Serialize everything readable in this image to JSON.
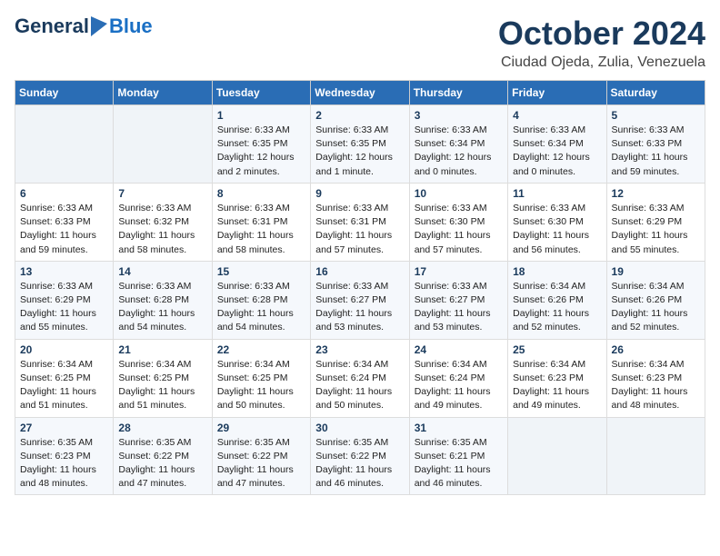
{
  "header": {
    "logo_general": "General",
    "logo_blue": "Blue",
    "month": "October 2024",
    "location": "Ciudad Ojeda, Zulia, Venezuela"
  },
  "days_of_week": [
    "Sunday",
    "Monday",
    "Tuesday",
    "Wednesday",
    "Thursday",
    "Friday",
    "Saturday"
  ],
  "weeks": [
    [
      null,
      null,
      {
        "day": "1",
        "sunrise": "Sunrise: 6:33 AM",
        "sunset": "Sunset: 6:35 PM",
        "daylight": "Daylight: 12 hours and 2 minutes."
      },
      {
        "day": "2",
        "sunrise": "Sunrise: 6:33 AM",
        "sunset": "Sunset: 6:35 PM",
        "daylight": "Daylight: 12 hours and 1 minute."
      },
      {
        "day": "3",
        "sunrise": "Sunrise: 6:33 AM",
        "sunset": "Sunset: 6:34 PM",
        "daylight": "Daylight: 12 hours and 0 minutes."
      },
      {
        "day": "4",
        "sunrise": "Sunrise: 6:33 AM",
        "sunset": "Sunset: 6:34 PM",
        "daylight": "Daylight: 12 hours and 0 minutes."
      },
      {
        "day": "5",
        "sunrise": "Sunrise: 6:33 AM",
        "sunset": "Sunset: 6:33 PM",
        "daylight": "Daylight: 11 hours and 59 minutes."
      }
    ],
    [
      {
        "day": "6",
        "sunrise": "Sunrise: 6:33 AM",
        "sunset": "Sunset: 6:33 PM",
        "daylight": "Daylight: 11 hours and 59 minutes."
      },
      {
        "day": "7",
        "sunrise": "Sunrise: 6:33 AM",
        "sunset": "Sunset: 6:32 PM",
        "daylight": "Daylight: 11 hours and 58 minutes."
      },
      {
        "day": "8",
        "sunrise": "Sunrise: 6:33 AM",
        "sunset": "Sunset: 6:31 PM",
        "daylight": "Daylight: 11 hours and 58 minutes."
      },
      {
        "day": "9",
        "sunrise": "Sunrise: 6:33 AM",
        "sunset": "Sunset: 6:31 PM",
        "daylight": "Daylight: 11 hours and 57 minutes."
      },
      {
        "day": "10",
        "sunrise": "Sunrise: 6:33 AM",
        "sunset": "Sunset: 6:30 PM",
        "daylight": "Daylight: 11 hours and 57 minutes."
      },
      {
        "day": "11",
        "sunrise": "Sunrise: 6:33 AM",
        "sunset": "Sunset: 6:30 PM",
        "daylight": "Daylight: 11 hours and 56 minutes."
      },
      {
        "day": "12",
        "sunrise": "Sunrise: 6:33 AM",
        "sunset": "Sunset: 6:29 PM",
        "daylight": "Daylight: 11 hours and 55 minutes."
      }
    ],
    [
      {
        "day": "13",
        "sunrise": "Sunrise: 6:33 AM",
        "sunset": "Sunset: 6:29 PM",
        "daylight": "Daylight: 11 hours and 55 minutes."
      },
      {
        "day": "14",
        "sunrise": "Sunrise: 6:33 AM",
        "sunset": "Sunset: 6:28 PM",
        "daylight": "Daylight: 11 hours and 54 minutes."
      },
      {
        "day": "15",
        "sunrise": "Sunrise: 6:33 AM",
        "sunset": "Sunset: 6:28 PM",
        "daylight": "Daylight: 11 hours and 54 minutes."
      },
      {
        "day": "16",
        "sunrise": "Sunrise: 6:33 AM",
        "sunset": "Sunset: 6:27 PM",
        "daylight": "Daylight: 11 hours and 53 minutes."
      },
      {
        "day": "17",
        "sunrise": "Sunrise: 6:33 AM",
        "sunset": "Sunset: 6:27 PM",
        "daylight": "Daylight: 11 hours and 53 minutes."
      },
      {
        "day": "18",
        "sunrise": "Sunrise: 6:34 AM",
        "sunset": "Sunset: 6:26 PM",
        "daylight": "Daylight: 11 hours and 52 minutes."
      },
      {
        "day": "19",
        "sunrise": "Sunrise: 6:34 AM",
        "sunset": "Sunset: 6:26 PM",
        "daylight": "Daylight: 11 hours and 52 minutes."
      }
    ],
    [
      {
        "day": "20",
        "sunrise": "Sunrise: 6:34 AM",
        "sunset": "Sunset: 6:25 PM",
        "daylight": "Daylight: 11 hours and 51 minutes."
      },
      {
        "day": "21",
        "sunrise": "Sunrise: 6:34 AM",
        "sunset": "Sunset: 6:25 PM",
        "daylight": "Daylight: 11 hours and 51 minutes."
      },
      {
        "day": "22",
        "sunrise": "Sunrise: 6:34 AM",
        "sunset": "Sunset: 6:25 PM",
        "daylight": "Daylight: 11 hours and 50 minutes."
      },
      {
        "day": "23",
        "sunrise": "Sunrise: 6:34 AM",
        "sunset": "Sunset: 6:24 PM",
        "daylight": "Daylight: 11 hours and 50 minutes."
      },
      {
        "day": "24",
        "sunrise": "Sunrise: 6:34 AM",
        "sunset": "Sunset: 6:24 PM",
        "daylight": "Daylight: 11 hours and 49 minutes."
      },
      {
        "day": "25",
        "sunrise": "Sunrise: 6:34 AM",
        "sunset": "Sunset: 6:23 PM",
        "daylight": "Daylight: 11 hours and 49 minutes."
      },
      {
        "day": "26",
        "sunrise": "Sunrise: 6:34 AM",
        "sunset": "Sunset: 6:23 PM",
        "daylight": "Daylight: 11 hours and 48 minutes."
      }
    ],
    [
      {
        "day": "27",
        "sunrise": "Sunrise: 6:35 AM",
        "sunset": "Sunset: 6:23 PM",
        "daylight": "Daylight: 11 hours and 48 minutes."
      },
      {
        "day": "28",
        "sunrise": "Sunrise: 6:35 AM",
        "sunset": "Sunset: 6:22 PM",
        "daylight": "Daylight: 11 hours and 47 minutes."
      },
      {
        "day": "29",
        "sunrise": "Sunrise: 6:35 AM",
        "sunset": "Sunset: 6:22 PM",
        "daylight": "Daylight: 11 hours and 47 minutes."
      },
      {
        "day": "30",
        "sunrise": "Sunrise: 6:35 AM",
        "sunset": "Sunset: 6:22 PM",
        "daylight": "Daylight: 11 hours and 46 minutes."
      },
      {
        "day": "31",
        "sunrise": "Sunrise: 6:35 AM",
        "sunset": "Sunset: 6:21 PM",
        "daylight": "Daylight: 11 hours and 46 minutes."
      },
      null,
      null
    ]
  ]
}
